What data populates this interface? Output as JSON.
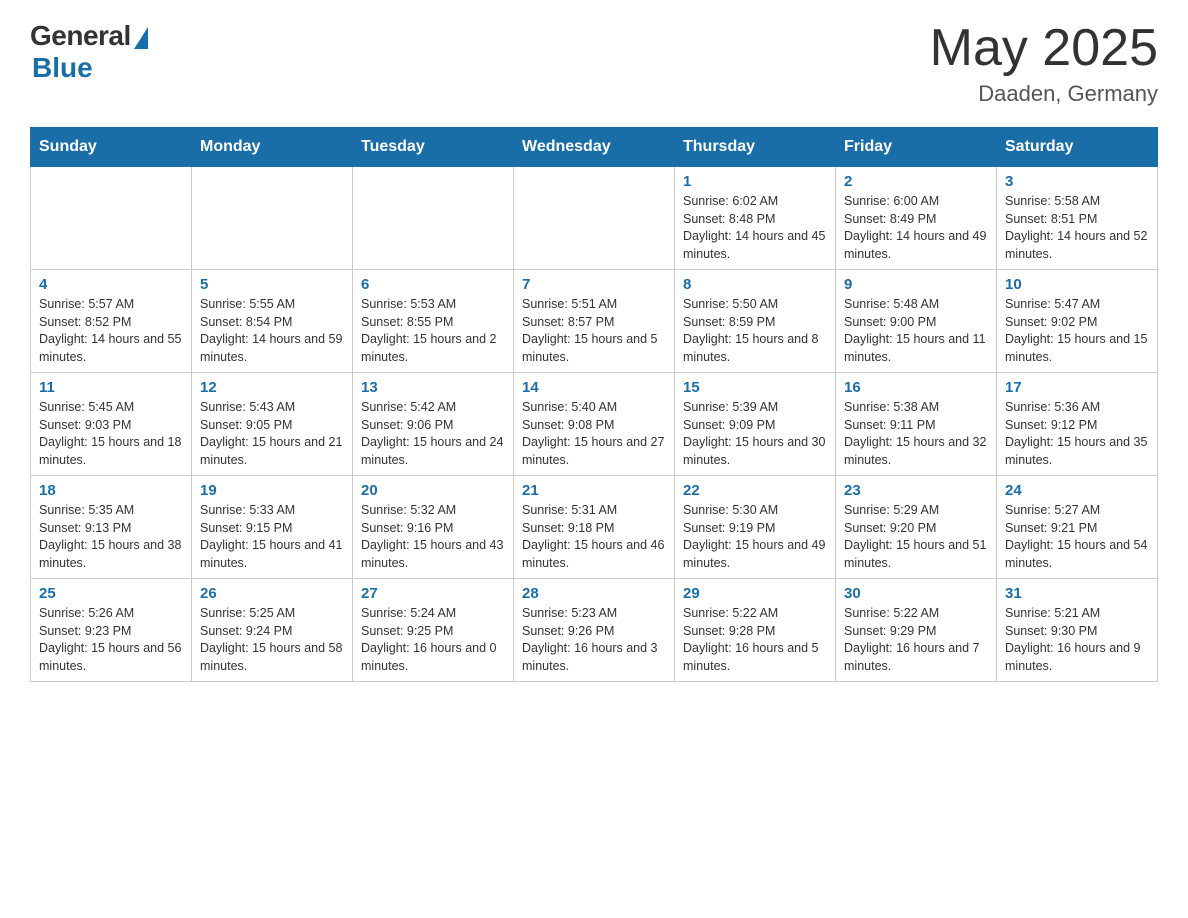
{
  "header": {
    "logo_general": "General",
    "logo_blue": "Blue",
    "title": "May 2025",
    "location": "Daaden, Germany"
  },
  "calendar": {
    "days_of_week": [
      "Sunday",
      "Monday",
      "Tuesday",
      "Wednesday",
      "Thursday",
      "Friday",
      "Saturday"
    ],
    "weeks": [
      [
        {
          "day": "",
          "info": ""
        },
        {
          "day": "",
          "info": ""
        },
        {
          "day": "",
          "info": ""
        },
        {
          "day": "",
          "info": ""
        },
        {
          "day": "1",
          "info": "Sunrise: 6:02 AM\nSunset: 8:48 PM\nDaylight: 14 hours and 45 minutes."
        },
        {
          "day": "2",
          "info": "Sunrise: 6:00 AM\nSunset: 8:49 PM\nDaylight: 14 hours and 49 minutes."
        },
        {
          "day": "3",
          "info": "Sunrise: 5:58 AM\nSunset: 8:51 PM\nDaylight: 14 hours and 52 minutes."
        }
      ],
      [
        {
          "day": "4",
          "info": "Sunrise: 5:57 AM\nSunset: 8:52 PM\nDaylight: 14 hours and 55 minutes."
        },
        {
          "day": "5",
          "info": "Sunrise: 5:55 AM\nSunset: 8:54 PM\nDaylight: 14 hours and 59 minutes."
        },
        {
          "day": "6",
          "info": "Sunrise: 5:53 AM\nSunset: 8:55 PM\nDaylight: 15 hours and 2 minutes."
        },
        {
          "day": "7",
          "info": "Sunrise: 5:51 AM\nSunset: 8:57 PM\nDaylight: 15 hours and 5 minutes."
        },
        {
          "day": "8",
          "info": "Sunrise: 5:50 AM\nSunset: 8:59 PM\nDaylight: 15 hours and 8 minutes."
        },
        {
          "day": "9",
          "info": "Sunrise: 5:48 AM\nSunset: 9:00 PM\nDaylight: 15 hours and 11 minutes."
        },
        {
          "day": "10",
          "info": "Sunrise: 5:47 AM\nSunset: 9:02 PM\nDaylight: 15 hours and 15 minutes."
        }
      ],
      [
        {
          "day": "11",
          "info": "Sunrise: 5:45 AM\nSunset: 9:03 PM\nDaylight: 15 hours and 18 minutes."
        },
        {
          "day": "12",
          "info": "Sunrise: 5:43 AM\nSunset: 9:05 PM\nDaylight: 15 hours and 21 minutes."
        },
        {
          "day": "13",
          "info": "Sunrise: 5:42 AM\nSunset: 9:06 PM\nDaylight: 15 hours and 24 minutes."
        },
        {
          "day": "14",
          "info": "Sunrise: 5:40 AM\nSunset: 9:08 PM\nDaylight: 15 hours and 27 minutes."
        },
        {
          "day": "15",
          "info": "Sunrise: 5:39 AM\nSunset: 9:09 PM\nDaylight: 15 hours and 30 minutes."
        },
        {
          "day": "16",
          "info": "Sunrise: 5:38 AM\nSunset: 9:11 PM\nDaylight: 15 hours and 32 minutes."
        },
        {
          "day": "17",
          "info": "Sunrise: 5:36 AM\nSunset: 9:12 PM\nDaylight: 15 hours and 35 minutes."
        }
      ],
      [
        {
          "day": "18",
          "info": "Sunrise: 5:35 AM\nSunset: 9:13 PM\nDaylight: 15 hours and 38 minutes."
        },
        {
          "day": "19",
          "info": "Sunrise: 5:33 AM\nSunset: 9:15 PM\nDaylight: 15 hours and 41 minutes."
        },
        {
          "day": "20",
          "info": "Sunrise: 5:32 AM\nSunset: 9:16 PM\nDaylight: 15 hours and 43 minutes."
        },
        {
          "day": "21",
          "info": "Sunrise: 5:31 AM\nSunset: 9:18 PM\nDaylight: 15 hours and 46 minutes."
        },
        {
          "day": "22",
          "info": "Sunrise: 5:30 AM\nSunset: 9:19 PM\nDaylight: 15 hours and 49 minutes."
        },
        {
          "day": "23",
          "info": "Sunrise: 5:29 AM\nSunset: 9:20 PM\nDaylight: 15 hours and 51 minutes."
        },
        {
          "day": "24",
          "info": "Sunrise: 5:27 AM\nSunset: 9:21 PM\nDaylight: 15 hours and 54 minutes."
        }
      ],
      [
        {
          "day": "25",
          "info": "Sunrise: 5:26 AM\nSunset: 9:23 PM\nDaylight: 15 hours and 56 minutes."
        },
        {
          "day": "26",
          "info": "Sunrise: 5:25 AM\nSunset: 9:24 PM\nDaylight: 15 hours and 58 minutes."
        },
        {
          "day": "27",
          "info": "Sunrise: 5:24 AM\nSunset: 9:25 PM\nDaylight: 16 hours and 0 minutes."
        },
        {
          "day": "28",
          "info": "Sunrise: 5:23 AM\nSunset: 9:26 PM\nDaylight: 16 hours and 3 minutes."
        },
        {
          "day": "29",
          "info": "Sunrise: 5:22 AM\nSunset: 9:28 PM\nDaylight: 16 hours and 5 minutes."
        },
        {
          "day": "30",
          "info": "Sunrise: 5:22 AM\nSunset: 9:29 PM\nDaylight: 16 hours and 7 minutes."
        },
        {
          "day": "31",
          "info": "Sunrise: 5:21 AM\nSunset: 9:30 PM\nDaylight: 16 hours and 9 minutes."
        }
      ]
    ]
  }
}
